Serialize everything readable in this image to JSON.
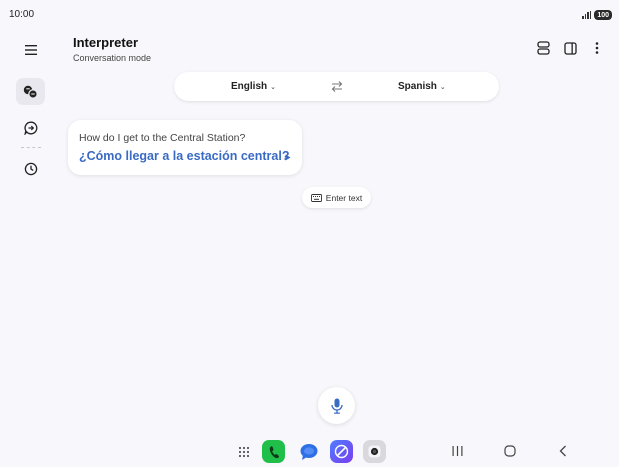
{
  "status_bar": {
    "time": "10:00",
    "battery": "100"
  },
  "sidebar": {
    "items": [
      {
        "icon": "menu-icon",
        "active": false
      },
      {
        "icon": "conversation-icon",
        "active": true
      },
      {
        "icon": "chat-forward-icon",
        "active": false
      },
      {
        "icon": "history-clock-icon",
        "active": false
      }
    ]
  },
  "header": {
    "title": "Interpreter",
    "subtitle": "Conversation mode",
    "actions": [
      "split-view-icon",
      "sidebar-panel-icon",
      "more-options-icon"
    ]
  },
  "language_bar": {
    "source_lang": "English",
    "target_lang": "Spanish"
  },
  "conversation": {
    "source_text": "How do I get to the Central Station?",
    "translated_text": "¿Cómo llegar a la estación central?"
  },
  "input": {
    "enter_text_label": "Enter text"
  },
  "dock": {
    "apps": [
      "app-drawer-icon",
      "phone-app-icon",
      "messages-app-icon",
      "browser-app-icon",
      "camera-app-icon"
    ]
  },
  "colors": {
    "accent": "#3a6bc4",
    "background": "#f8f8fc",
    "phone_green": "#1fbf4a"
  }
}
